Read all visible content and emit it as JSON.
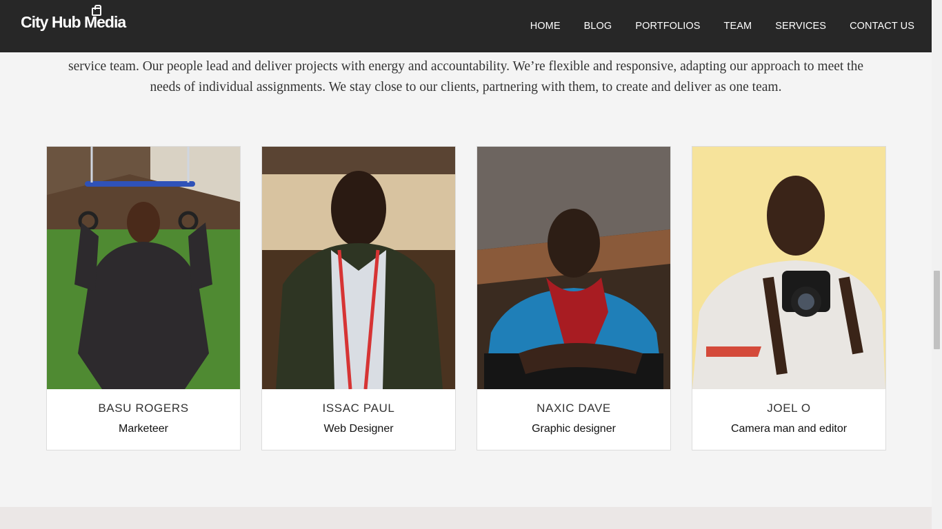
{
  "brand": {
    "logo_text": "City Hub Media"
  },
  "nav": {
    "items": [
      "HOME",
      "BLOG",
      "PORTFOLIOS",
      "TEAM",
      "SERVICES",
      "CONTACT US"
    ]
  },
  "intro": {
    "line1": "service team. Our people lead and deliver projects with energy and accountability. We’re flexible and responsive, adapting our approach to meet the",
    "line2": "needs of individual assignments. We stay close to our clients, partnering with them, to create and deliver as one team."
  },
  "team": [
    {
      "name": "BASU ROGERS",
      "role": "Marketeer"
    },
    {
      "name": "ISSAC PAUL",
      "role": "Web Designer"
    },
    {
      "name": "NAXIC DAVE",
      "role": "Graphic designer"
    },
    {
      "name": "JOEL O",
      "role": "Camera man and editor"
    }
  ],
  "colors": {
    "navbar": "#272727",
    "page_bg": "#f4f4f4",
    "footer_band": "#ebe7e6"
  }
}
